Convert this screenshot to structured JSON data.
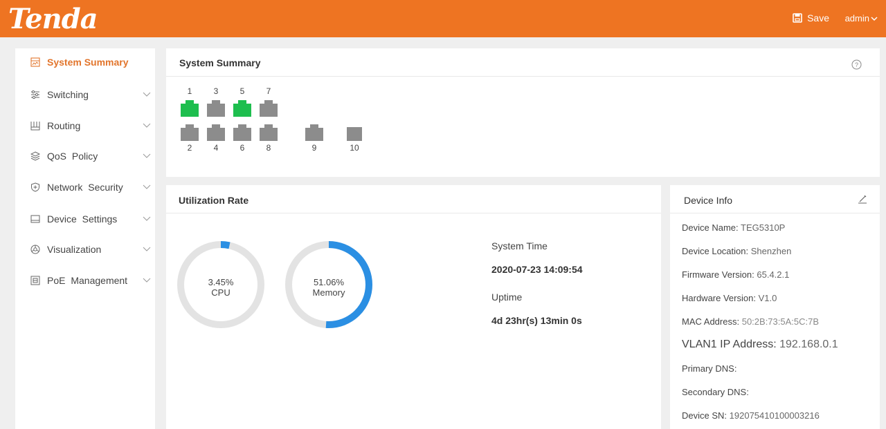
{
  "header": {
    "logo": "Tenda",
    "save_label": "Save",
    "user_label": "admin",
    "color": "#ee7422"
  },
  "sidebar": {
    "items": [
      {
        "label": "System Summary",
        "icon": "chart-icon",
        "active": true
      },
      {
        "label": "Switching",
        "icon": "sliders-icon"
      },
      {
        "label": "Routing",
        "icon": "routing-icon"
      },
      {
        "label": "QoS Policy",
        "icon": "layers-icon"
      },
      {
        "label": "Network Security",
        "icon": "shield-icon"
      },
      {
        "label": "Device Settings",
        "icon": "monitor-icon"
      },
      {
        "label": "Visualization",
        "icon": "aperture-icon"
      },
      {
        "label": "PoE Management",
        "icon": "poe-icon"
      }
    ],
    "active_color": "#e2752c"
  },
  "summary": {
    "title": "System Summary",
    "ports_top": [
      "1",
      "3",
      "5",
      "7"
    ],
    "ports_bottom": [
      "2",
      "4",
      "6",
      "8",
      "9",
      "10"
    ],
    "active_ports": [
      "1",
      "5"
    ],
    "colors": {
      "active": "#1ebe4e",
      "inactive": "#8c8c8c"
    }
  },
  "utilization": {
    "title": "Utilization Rate",
    "cpu": {
      "percent": "3.45%",
      "value": 3.45,
      "label": "CPU"
    },
    "memory": {
      "percent": "51.06%",
      "value": 51.06,
      "label": "Memory"
    },
    "system_time_label": "System Time",
    "system_time": "2020-07-23 14:09:54",
    "uptime_label": "Uptime",
    "uptime": "4d 23hr(s) 13min 0s",
    "colors": {
      "arc": "#2b8fe3",
      "track": "#e3e3e3"
    }
  },
  "device_info": {
    "title": "Device Info",
    "rows": [
      {
        "label": "Device Name:",
        "value": "TEG5310P"
      },
      {
        "label": "Device Location:",
        "value": "Shenzhen"
      },
      {
        "label": "Firmware Version:",
        "value": "65.4.2.1"
      },
      {
        "label": "Hardware Version:",
        "value": "V1.0"
      },
      {
        "label": "MAC Address:",
        "value": "50:2B:73:5A:5C:7B"
      },
      {
        "label": "VLAN1 IP Address:",
        "value": "192.168.0.1"
      },
      {
        "label": "Primary DNS:",
        "value": ""
      },
      {
        "label": "Secondary DNS:",
        "value": ""
      },
      {
        "label": "Device SN:",
        "value": "192075410100003216"
      }
    ]
  }
}
